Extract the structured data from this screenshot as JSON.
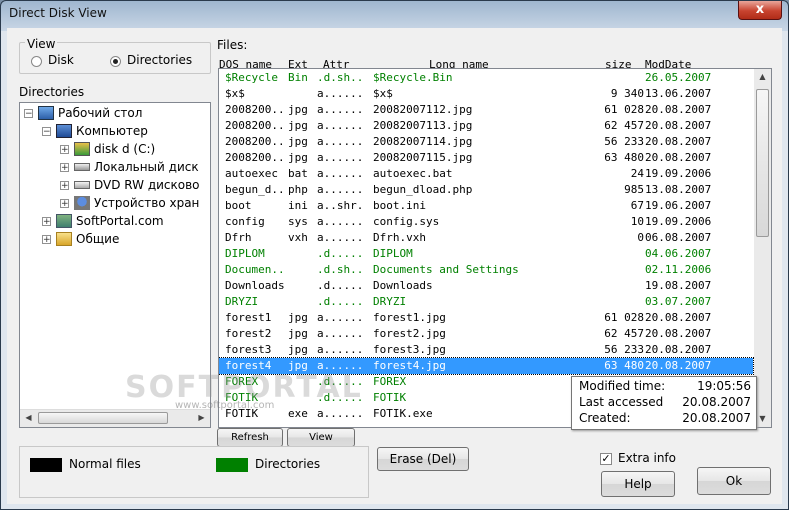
{
  "window": {
    "title": "Direct Disk View",
    "close_label": "x"
  },
  "view": {
    "group_label": "View",
    "options": [
      {
        "label": "Disk",
        "selected": false
      },
      {
        "label": "Directories",
        "selected": true
      }
    ]
  },
  "directories": {
    "label": "Directories",
    "items": [
      {
        "label": "Рабочий стол",
        "expander": "−",
        "icon": "desktop-icon"
      },
      {
        "label": "Компьютер",
        "expander": "−",
        "icon": "computer-icon"
      },
      {
        "label": "disk d (C:)",
        "expander": "+",
        "icon": "drive-icon"
      },
      {
        "label": "Локальный диск",
        "expander": "+",
        "icon": "drive-icon"
      },
      {
        "label": "DVD RW дисково",
        "expander": "+",
        "icon": "dvd-drive-icon"
      },
      {
        "label": "Устройство хран",
        "expander": "+",
        "icon": "storage-device-icon"
      },
      {
        "label": "SoftPortal.com",
        "expander": "+",
        "icon": "folder-icon"
      },
      {
        "label": "Общие",
        "expander": "+",
        "icon": "folder-icon"
      }
    ]
  },
  "files": {
    "label": "Files:",
    "columns": {
      "dos_name": "DOS name",
      "ext": "Ext",
      "attr": "Attr",
      "long_name": "Long name",
      "size": "size",
      "moddate": "ModDate"
    },
    "rows": [
      {
        "dos": "$Recycle",
        "ext": "Bin",
        "attr": ".d.sh..",
        "long": "$Recycle.Bin",
        "size": "",
        "date": "26.05.2007",
        "dir": true
      },
      {
        "dos": "$x$",
        "ext": "",
        "attr": "a......",
        "long": "$x$",
        "size": "9 340",
        "date": "13.06.2007",
        "dir": false
      },
      {
        "dos": "2008200..",
        "ext": "jpg",
        "attr": "a......",
        "long": "20082007112.jpg",
        "size": "61 028",
        "date": "20.08.2007",
        "dir": false
      },
      {
        "dos": "2008200..",
        "ext": "jpg",
        "attr": "a......",
        "long": "20082007113.jpg",
        "size": "62 457",
        "date": "20.08.2007",
        "dir": false
      },
      {
        "dos": "2008200..",
        "ext": "jpg",
        "attr": "a......",
        "long": "20082007114.jpg",
        "size": "56 233",
        "date": "20.08.2007",
        "dir": false
      },
      {
        "dos": "2008200..",
        "ext": "jpg",
        "attr": "a......",
        "long": "20082007115.jpg",
        "size": "63 480",
        "date": "20.08.2007",
        "dir": false
      },
      {
        "dos": "autoexec",
        "ext": "bat",
        "attr": "a......",
        "long": "autoexec.bat",
        "size": "24",
        "date": "19.09.2006",
        "dir": false
      },
      {
        "dos": "begun_d..",
        "ext": "php",
        "attr": "a......",
        "long": "begun_dload.php",
        "size": "985",
        "date": "13.08.2007",
        "dir": false
      },
      {
        "dos": "boot",
        "ext": "ini",
        "attr": "a..shr.",
        "long": "boot.ini",
        "size": "67",
        "date": "19.06.2007",
        "dir": false
      },
      {
        "dos": "config",
        "ext": "sys",
        "attr": "a......",
        "long": "config.sys",
        "size": "10",
        "date": "19.09.2006",
        "dir": false
      },
      {
        "dos": "Dfrh",
        "ext": "vxh",
        "attr": "a......",
        "long": "Dfrh.vxh",
        "size": "0",
        "date": "06.08.2007",
        "dir": false
      },
      {
        "dos": "DIPLOM",
        "ext": "",
        "attr": ".d.....",
        "long": "DIPLOM",
        "size": "",
        "date": "04.06.2007",
        "dir": true
      },
      {
        "dos": "Documen..",
        "ext": "",
        "attr": ".d.sh..",
        "long": "Documents and Settings",
        "size": "",
        "date": "02.11.2006",
        "dir": true
      },
      {
        "dos": "Downloads",
        "ext": "",
        "attr": ".d.....",
        "long": "Downloads",
        "size": "",
        "date": "19.08.2007",
        "dir": false
      },
      {
        "dos": "DRYZI",
        "ext": "",
        "attr": ".d.....",
        "long": "DRYZI",
        "size": "",
        "date": "03.07.2007",
        "dir": true
      },
      {
        "dos": "forest1",
        "ext": "jpg",
        "attr": "a......",
        "long": "forest1.jpg",
        "size": "61 028",
        "date": "20.08.2007",
        "dir": false
      },
      {
        "dos": "forest2",
        "ext": "jpg",
        "attr": "a......",
        "long": "forest2.jpg",
        "size": "62 457",
        "date": "20.08.2007",
        "dir": false
      },
      {
        "dos": "forest3",
        "ext": "jpg",
        "attr": "a......",
        "long": "forest3.jpg",
        "size": "56 233",
        "date": "20.08.2007",
        "dir": false
      },
      {
        "dos": "forest4",
        "ext": "jpg",
        "attr": "a......",
        "long": "forest4.jpg",
        "size": "63 480",
        "date": "20.08.2007",
        "dir": false,
        "selected": true
      },
      {
        "dos": "FOREX",
        "ext": "",
        "attr": ".d.....",
        "long": "FOREX",
        "size": "",
        "date": "",
        "dir": true
      },
      {
        "dos": "FOTIK",
        "ext": "",
        "attr": ".d.....",
        "long": "FOTIK",
        "size": "",
        "date": "",
        "dir": true
      },
      {
        "dos": "FOTIK",
        "ext": "exe",
        "attr": "a......",
        "long": "FOTIK.exe",
        "size": "",
        "date": "",
        "dir": false
      }
    ]
  },
  "tooltip": {
    "modified_label": "Modified time:",
    "modified_value": "19:05:56",
    "accessed_label": "Last accessed",
    "accessed_value": "20.08.2007",
    "created_label": "Created:",
    "created_value": "20.08.2007"
  },
  "buttons": {
    "refresh": "Refresh",
    "view": "View",
    "erase": "Erase (Del)",
    "help": "Help",
    "ok": "Ok"
  },
  "legend": {
    "normal_label": "Normal files",
    "normal_color": "#000000",
    "dir_label": "Directories",
    "dir_color": "#008000"
  },
  "extra_info": {
    "label": "Extra info",
    "checked": true,
    "mark": "✓"
  },
  "watermark": {
    "text": "SOFTPORTAL",
    "url": "www.softportal.com"
  }
}
